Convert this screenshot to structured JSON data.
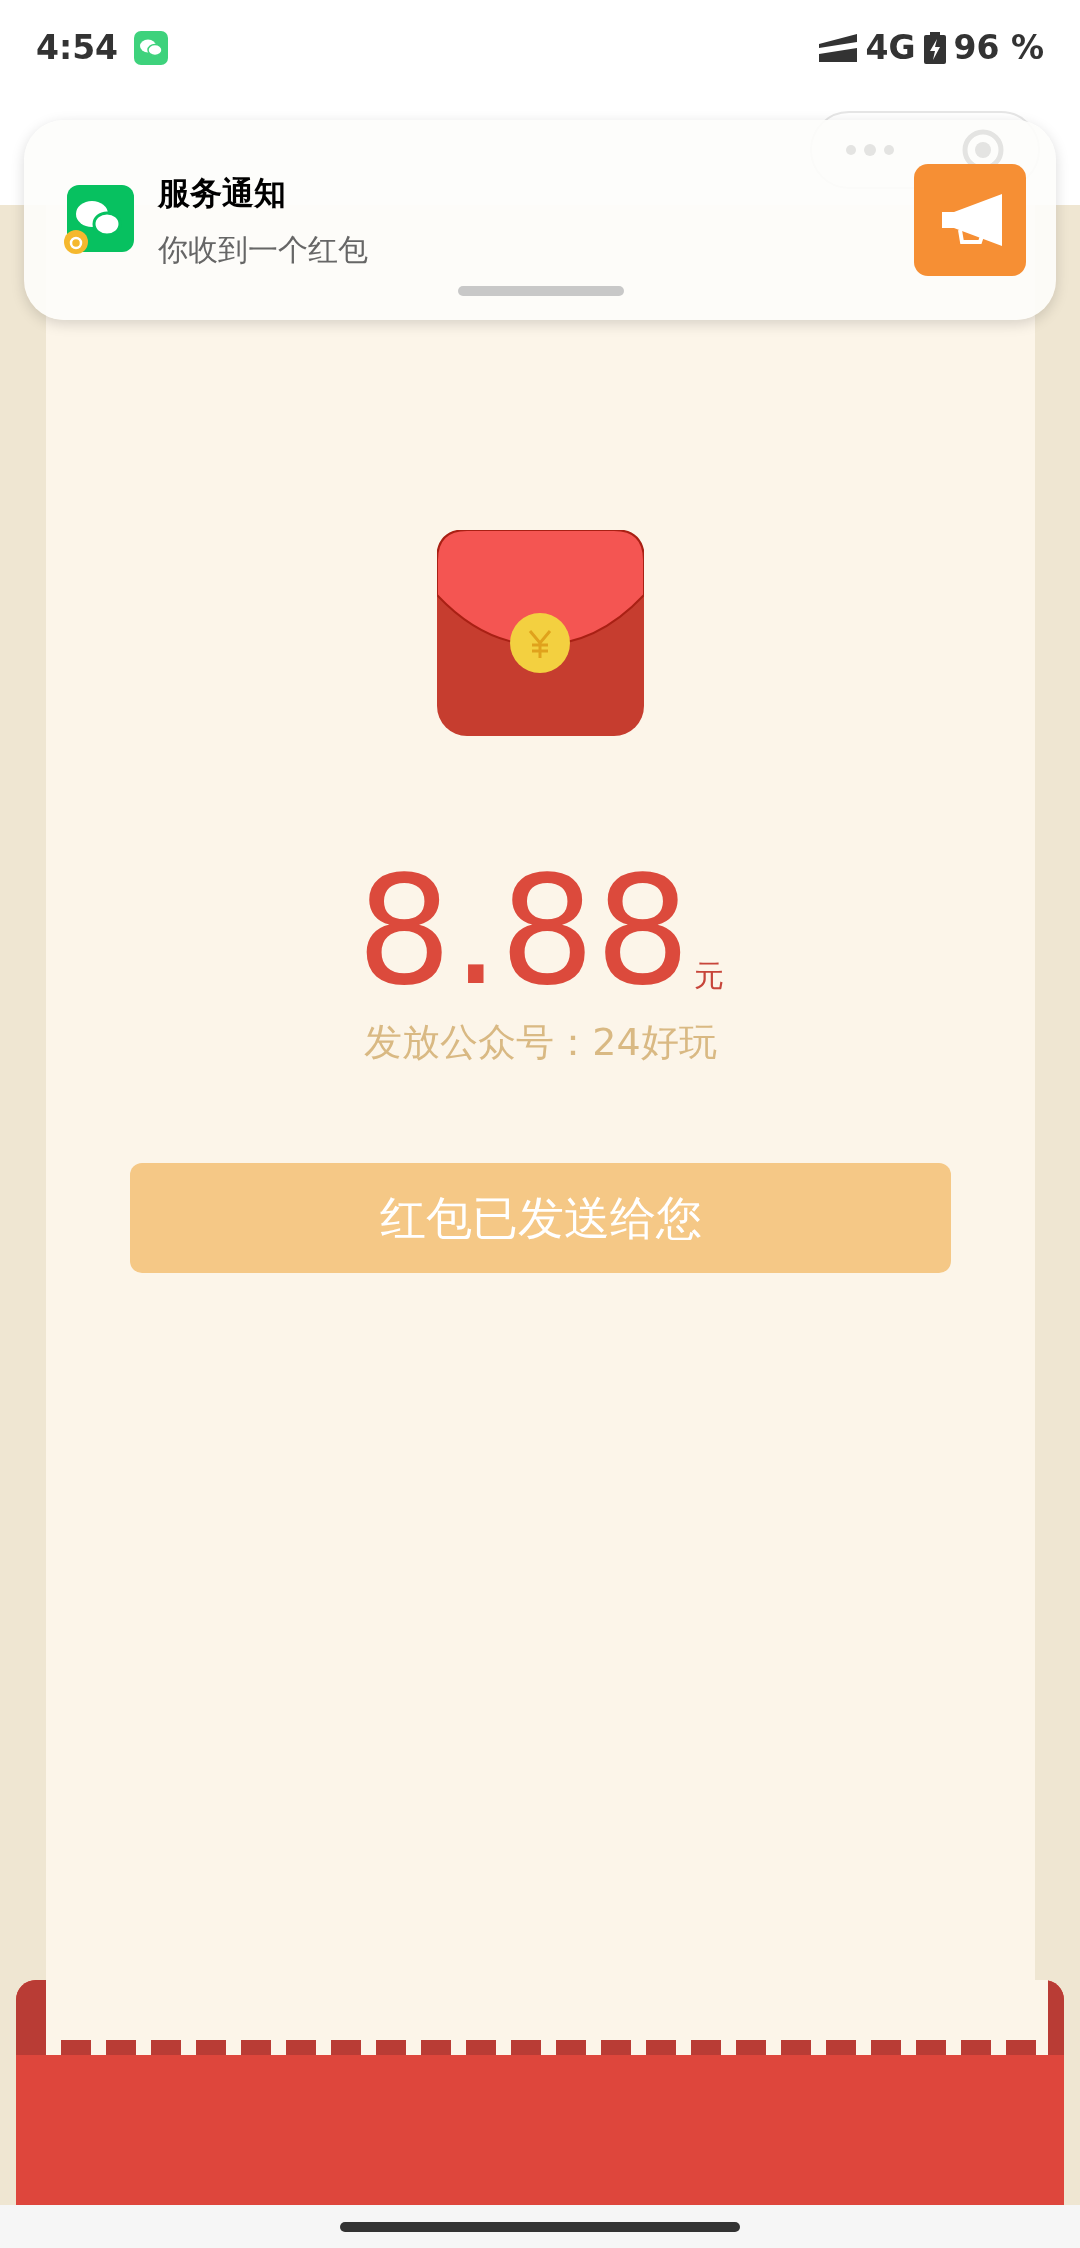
{
  "status_bar": {
    "time": "4:54",
    "network": "4G",
    "battery": "96 %"
  },
  "notification": {
    "title": "服务通知",
    "message": "你收到一个红包"
  },
  "red_packet": {
    "amount": "8.88",
    "unit": "元",
    "sender": "发放公众号：24好玩"
  },
  "button": {
    "label": "红包已发送给您"
  }
}
